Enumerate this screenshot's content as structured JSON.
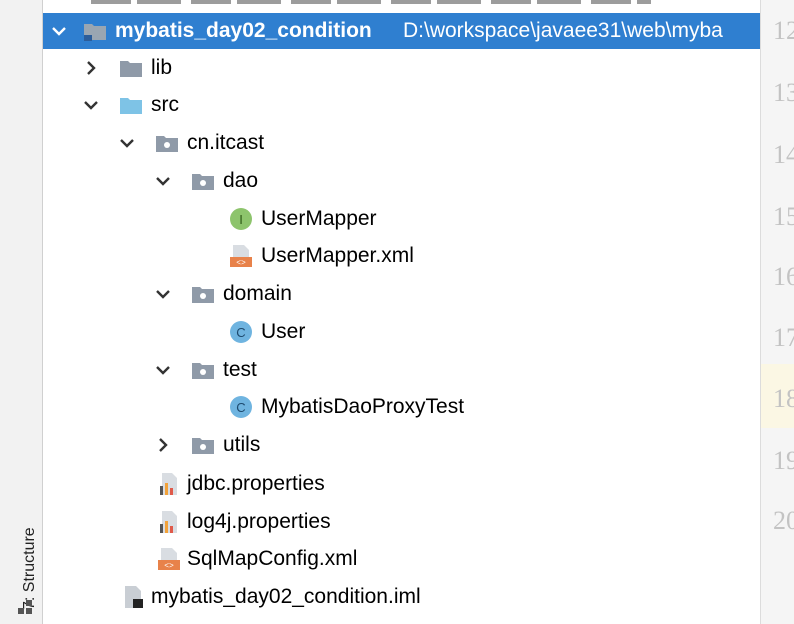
{
  "sidebar": {
    "structure_label": "7: Structure"
  },
  "tree": {
    "project": {
      "name": "mybatis_day02_condition",
      "path": "D:\\workspace\\javaee31\\web\\myba"
    },
    "lib": "lib",
    "src": "src",
    "pkg_root": "cn.itcast",
    "dao": "dao",
    "user_mapper": "UserMapper",
    "user_mapper_xml": "UserMapper.xml",
    "domain": "domain",
    "user": "User",
    "test": "test",
    "test_class": "MybatisDaoProxyTest",
    "utils": "utils",
    "jdbc_props": "jdbc.properties",
    "log4j_props": "log4j.properties",
    "sqlmap_config": "SqlMapConfig.xml",
    "iml_file": "mybatis_day02_condition.iml"
  },
  "gutter": {
    "lines": [
      "12",
      "13",
      "14",
      "15",
      "16",
      "17",
      "18",
      "19",
      "20"
    ]
  },
  "colors": {
    "selection": "#2f7fd0",
    "folder": "#8f9aa8",
    "source_folder": "#7ec3e6",
    "interface": "#8dc46c",
    "class": "#6fb4e0",
    "xml": "#e8824a"
  }
}
